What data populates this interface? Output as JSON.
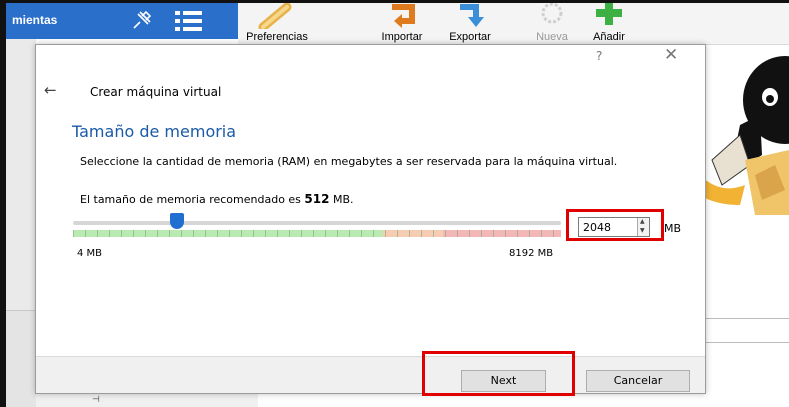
{
  "window": {
    "tools_label": "mientas",
    "toolbar": [
      {
        "name": "preferences",
        "label": "Preferencias",
        "enabled": true,
        "icon": "wrench-icon"
      },
      {
        "name": "import",
        "label": "Importar",
        "enabled": true,
        "icon": "import-arrow-icon"
      },
      {
        "name": "export",
        "label": "Exportar",
        "enabled": true,
        "icon": "export-arrow-icon"
      },
      {
        "name": "new",
        "label": "Nueva",
        "enabled": false,
        "icon": "new-gear-icon"
      },
      {
        "name": "add",
        "label": "Añadir",
        "enabled": true,
        "icon": "green-plus-icon"
      }
    ]
  },
  "dialog": {
    "help_glyph": "?",
    "close_glyph": "✕",
    "back_glyph": "←",
    "title": "Crear máquina virtual",
    "section_title": "Tamaño de memoria",
    "description": "Seleccione la cantidad de memoria (RAM) en megabytes a ser reservada para la máquina virtual.",
    "recommend_prefix": "El tamaño de memoria recomendado es ",
    "recommend_value": "512",
    "recommend_suffix": " MB.",
    "slider": {
      "min_label": "4 MB",
      "max_label": "8192 MB",
      "min": 4,
      "max": 8192,
      "value": 2048
    },
    "memory_value": "2048",
    "memory_unit": "MB",
    "buttons": {
      "next": "Next",
      "cancel": "Cancelar"
    }
  },
  "colors": {
    "section_title": "#1a5aa6",
    "highlight": "#e00000",
    "tools_strip": "#2a6fc9"
  }
}
